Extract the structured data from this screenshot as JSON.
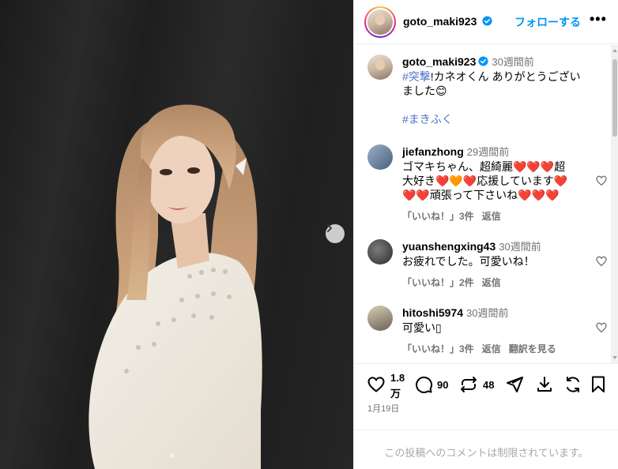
{
  "header": {
    "username": "goto_maki923",
    "follow_label": "フォローする",
    "more_label": "•••"
  },
  "caption": {
    "username": "goto_maki923",
    "time": "30週間前",
    "hashtag1": "#突撃",
    "text": "!カネオくん ありがとうございました",
    "emoji": "😊",
    "hashtag2": "#まきふく"
  },
  "comments": [
    {
      "username": "jiefanzhong",
      "time": "29週間前",
      "line1": "ゴマキちゃん、超綺麗❤️❤️❤️超",
      "line2": "大好き❤️🧡❤️応援しています❤️",
      "line3": "❤️❤️頑張って下さいね❤️❤️❤️",
      "likes": "「いいね！」3件",
      "reply": "返信"
    },
    {
      "username": "yuanshengxing43",
      "time": "30週間前",
      "line1": "お疲れでした。可愛いね！",
      "likes": "「いいね！」2件",
      "reply": "返信"
    },
    {
      "username": "hitoshi5974",
      "time": "30週間前",
      "line1": "可愛い▯",
      "likes": "「いいね！」3件",
      "reply": "返信",
      "translate": "翻訳を見る"
    }
  ],
  "actions": {
    "likes_line1": "1.8",
    "likes_line2": "万",
    "comments": "90",
    "reposts": "48",
    "date": "1月19日"
  },
  "footer": {
    "restricted": "この投稿へのコメントは制限されています。"
  },
  "colors": {
    "link": "#0095f6",
    "hashtag": "#4a74c9",
    "secondary": "#737373",
    "heart": "#e0245e"
  }
}
